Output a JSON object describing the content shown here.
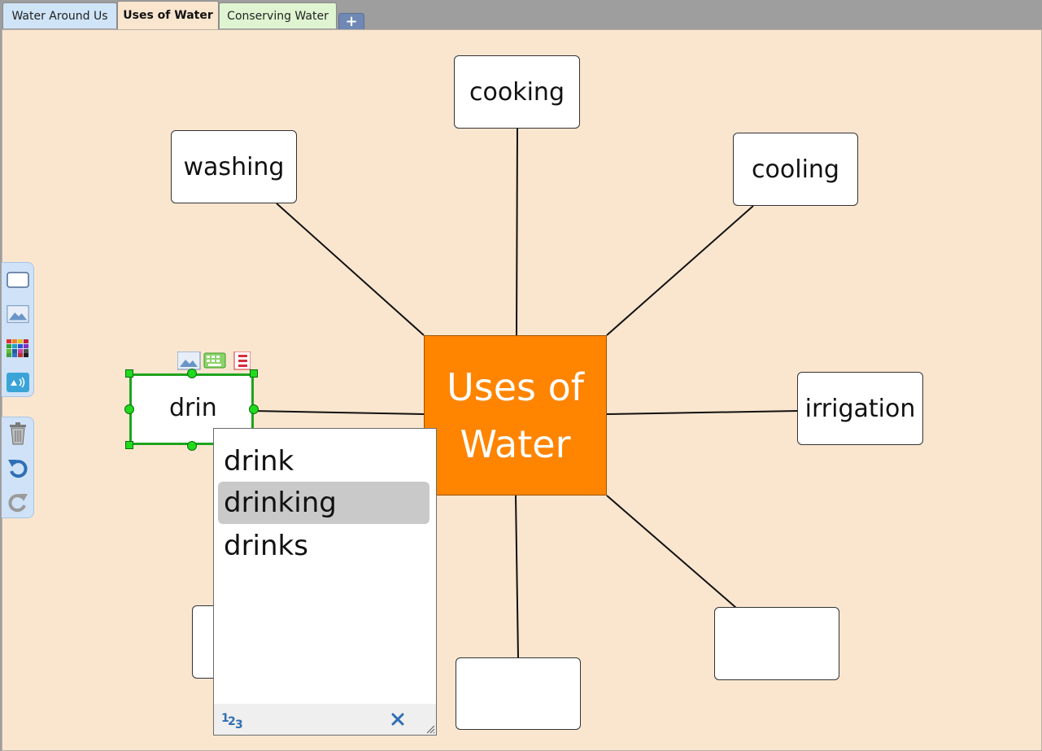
{
  "tabs": [
    {
      "label": "Water Around Us"
    },
    {
      "label": "Uses of Water"
    },
    {
      "label": "Conserving Water"
    }
  ],
  "add_tab_label": "+",
  "center": {
    "line1": "Uses of",
    "line2": "Water",
    "color": "#ff8400"
  },
  "nodes": {
    "cooking": "cooking",
    "washing": "washing",
    "cooling": "cooling",
    "irrigation": "irrigation"
  },
  "selected_node_text": "drin",
  "suggestions": [
    "drink",
    "drinking",
    "drinks"
  ],
  "highlighted_suggestion": "drinking",
  "toolbar_icons": [
    "text-box-icon",
    "picture-icon",
    "color-palette-icon",
    "speech-icon",
    "trash-icon",
    "undo-icon",
    "redo-icon"
  ],
  "popup_footer": {
    "numbers_icon": "123-icon",
    "close_icon": "close-icon"
  },
  "colors": {
    "canvas": "#fae6cf",
    "selection": "#1fa31f",
    "center": "#ff8400"
  }
}
